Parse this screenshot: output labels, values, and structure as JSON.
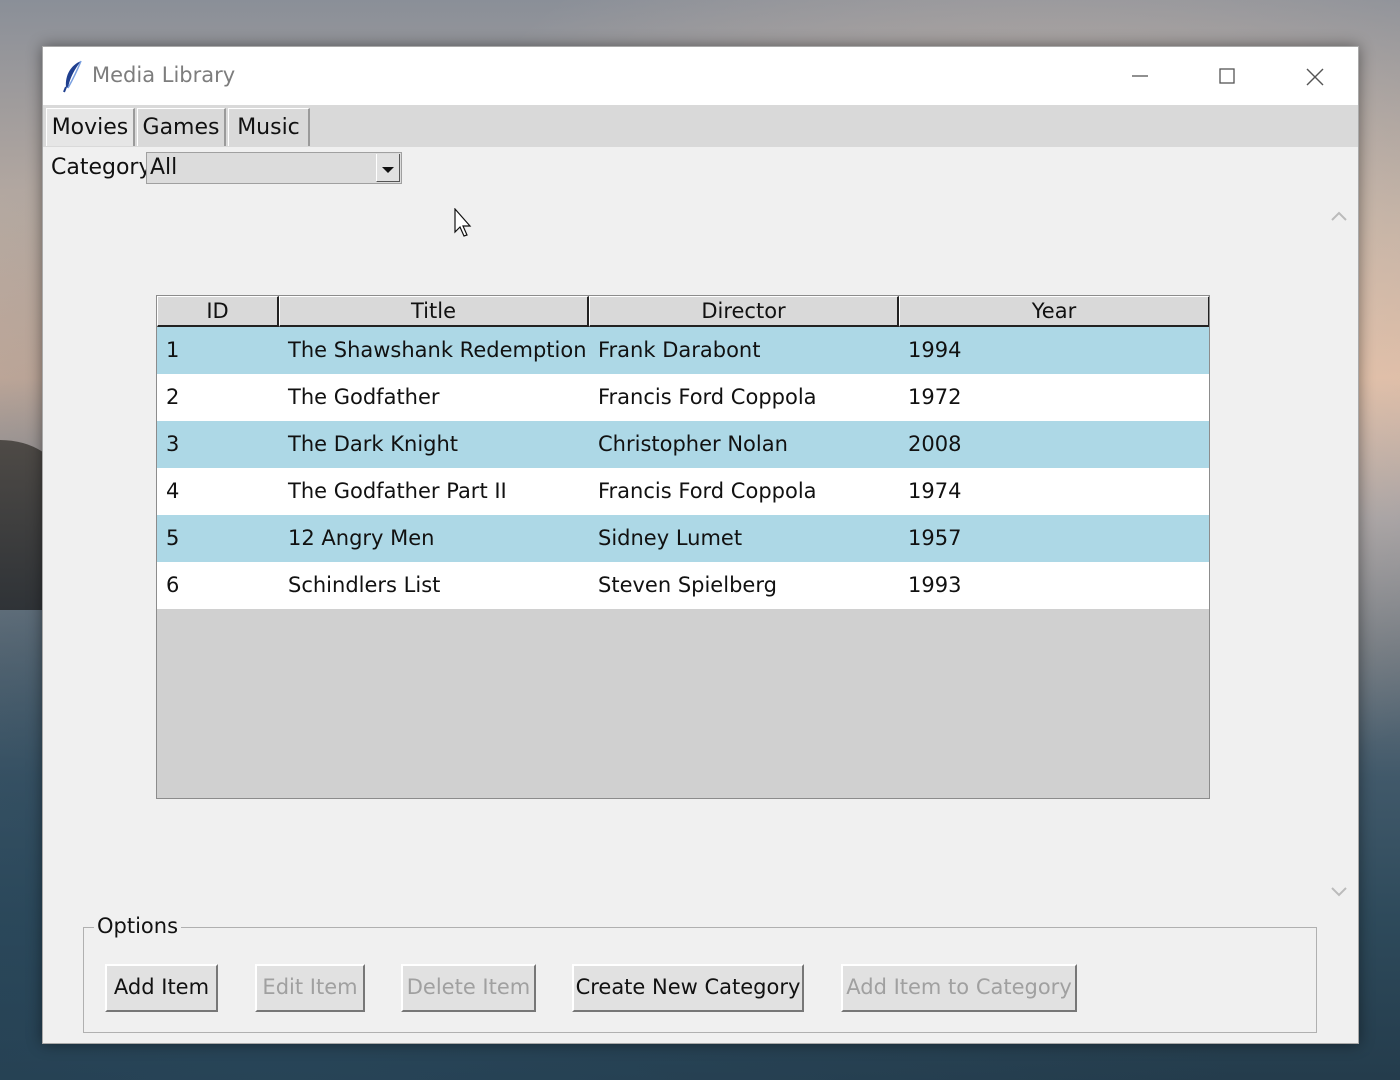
{
  "window": {
    "title": "Media Library",
    "icon": "feather-icon"
  },
  "tabs": [
    {
      "label": "Movies",
      "active": true
    },
    {
      "label": "Games",
      "active": false
    },
    {
      "label": "Music",
      "active": false
    }
  ],
  "filter": {
    "label": "Category",
    "value": "All"
  },
  "table": {
    "columns": [
      "ID",
      "Title",
      "Director",
      "Year"
    ],
    "rows": [
      [
        "1",
        "The Shawshank Redemption",
        "Frank Darabont",
        "1994"
      ],
      [
        "2",
        "The Godfather",
        "Francis Ford Coppola",
        "1972"
      ],
      [
        "3",
        "The Dark Knight",
        "Christopher Nolan",
        "2008"
      ],
      [
        "4",
        "The Godfather Part II",
        "Francis Ford Coppola",
        "1974"
      ],
      [
        "5",
        "12 Angry Men",
        "Sidney Lumet",
        "1957"
      ],
      [
        "6",
        "Schindlers List",
        "Steven Spielberg",
        "1993"
      ]
    ],
    "row_colors": {
      "odd": "#add8e6",
      "even": "#ffffff"
    }
  },
  "options": {
    "legend": "Options",
    "buttons": [
      {
        "label": "Add Item",
        "enabled": true
      },
      {
        "label": "Edit Item",
        "enabled": false
      },
      {
        "label": "Delete Item",
        "enabled": false
      },
      {
        "label": "Create New Category",
        "enabled": true
      },
      {
        "label": "Add Item to Category",
        "enabled": false
      }
    ]
  }
}
